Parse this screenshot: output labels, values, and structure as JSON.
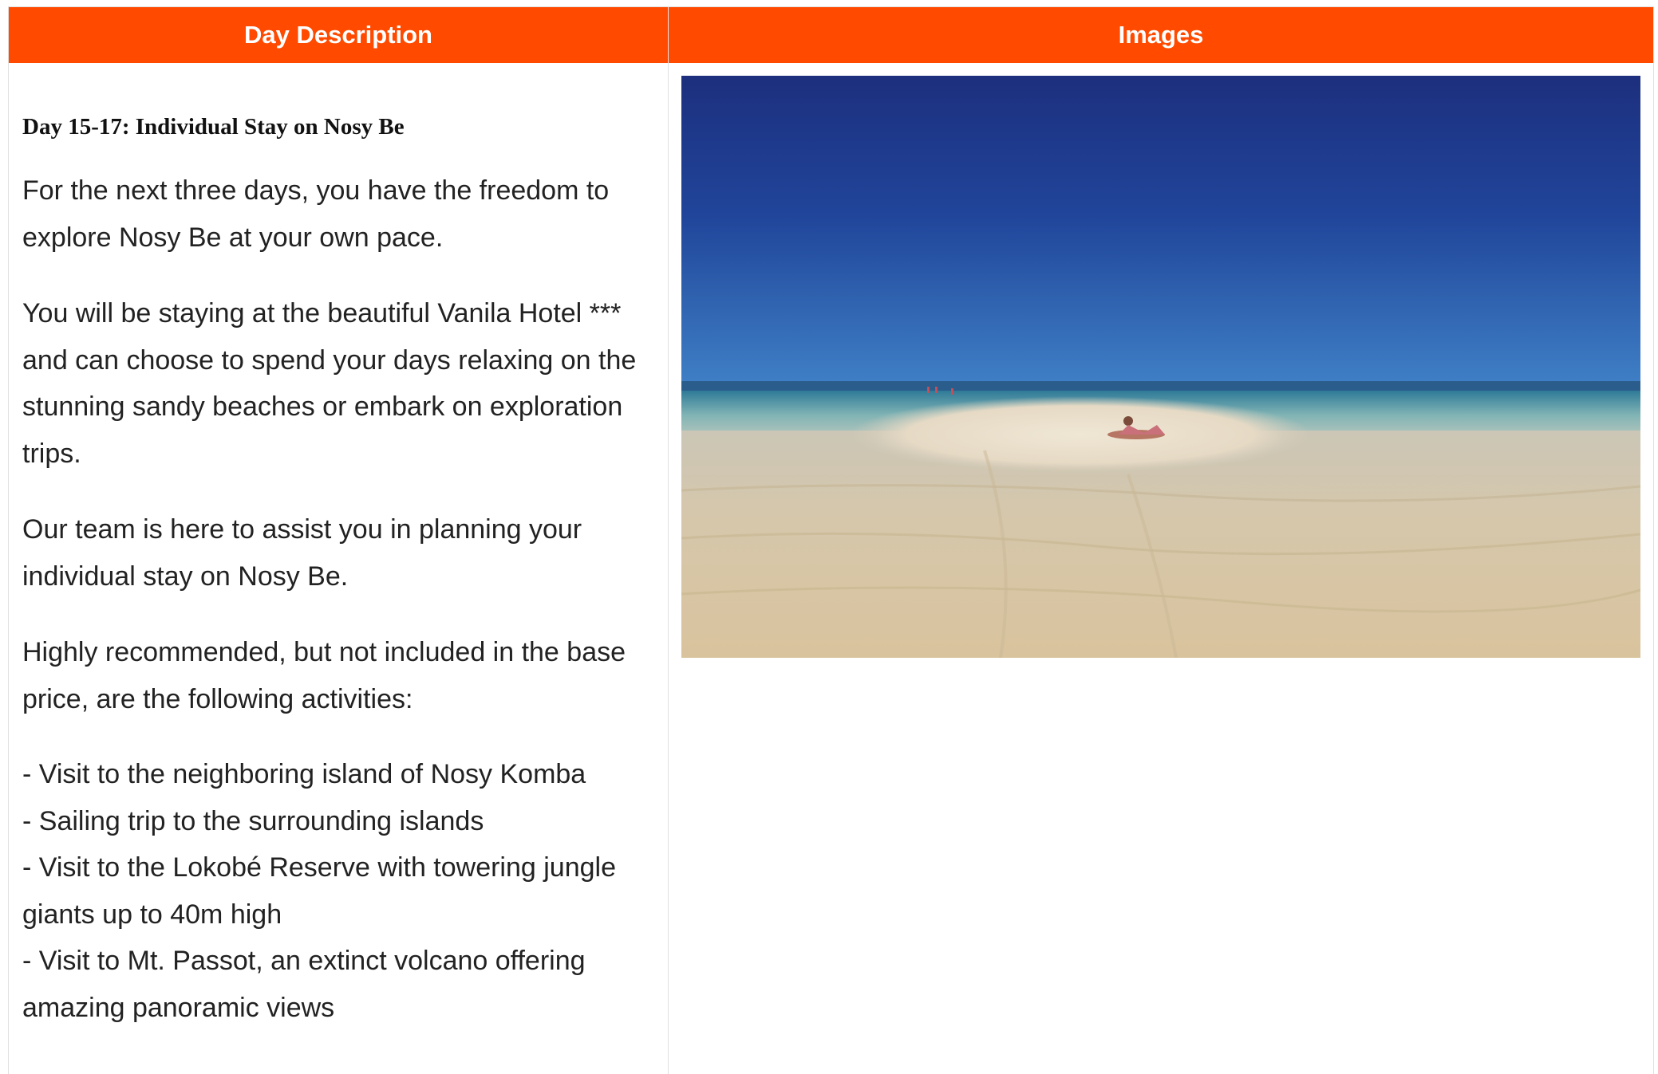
{
  "table": {
    "headers": {
      "description": "Day Description",
      "images": "Images"
    }
  },
  "day": {
    "title": "Day 15-17: Individual Stay on Nosy Be",
    "paragraphs": [
      "For the next three days, you have the freedom to explore Nosy Be at your own pace.",
      "You will be staying at the beautiful Vanila Hotel *** and can choose to spend your days relaxing on the stunning sandy beaches or embark on exploration trips.",
      "Our team is here to assist you in planning your individual stay on Nosy Be.",
      "Highly recommended, but not included in the base price, are the following activities:"
    ],
    "activities": [
      "- Visit to the neighboring island of Nosy Komba",
      "- Sailing trip to the surrounding islands",
      "- Visit to the Lokobé Reserve with towering jungle giants up to 40m high",
      "- Visit to Mt. Passot, an extinct volcano offering amazing panoramic views"
    ]
  },
  "colors": {
    "header_bg": "#ff4a00",
    "header_text": "#ffffff",
    "body_text": "#222222"
  }
}
